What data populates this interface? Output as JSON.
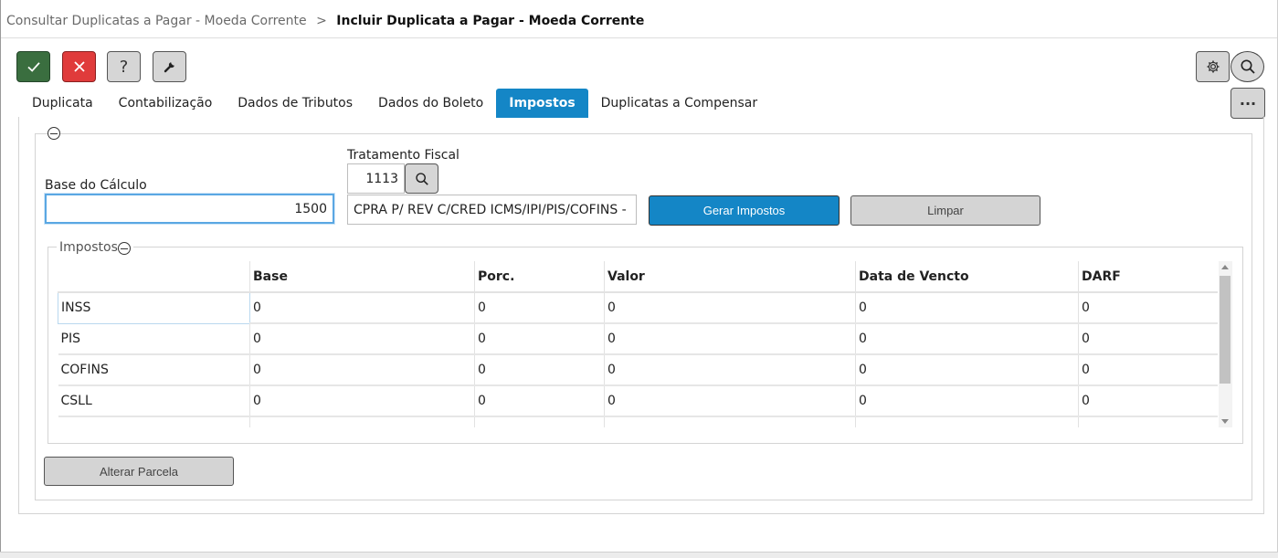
{
  "breadcrumb": {
    "parent": "Consultar Duplicatas a Pagar - Moeda Corrente",
    "separator": ">",
    "current": "Incluir Duplicata a Pagar - Moeda Corrente"
  },
  "toolbar": {
    "confirm_icon": "check-icon",
    "cancel_icon": "close-icon",
    "help_label": "?",
    "tools_icon": "wrench-icon",
    "settings_icon": "gear-icon",
    "search_icon": "search-icon",
    "more_label": "···"
  },
  "tabs": [
    {
      "label": "Duplicata",
      "active": false
    },
    {
      "label": "Contabilização",
      "active": false
    },
    {
      "label": "Dados de Tributos",
      "active": false
    },
    {
      "label": "Dados do Boleto",
      "active": false
    },
    {
      "label": "Impostos",
      "active": true
    },
    {
      "label": "Duplicatas a Compensar",
      "active": false
    }
  ],
  "form": {
    "base_label": "Base do Cálculo",
    "base_value": "1500",
    "tratamento_label": "Tratamento Fiscal",
    "tratamento_code": "1113",
    "tratamento_desc": "CPRA P/ REV C/CRED ICMS/IPI/PIS/COFINS - IF",
    "gerar_label": "Gerar Impostos",
    "limpar_label": "Limpar"
  },
  "impostos": {
    "legend": "Impostos",
    "columns": [
      "",
      "Base",
      "Porc.",
      "Valor",
      "Data de Vencto",
      "DARF"
    ],
    "rows": [
      [
        "INSS",
        "0",
        "0",
        "0",
        "0",
        "0"
      ],
      [
        "PIS",
        "0",
        "0",
        "0",
        "0",
        "0"
      ],
      [
        "COFINS",
        "0",
        "0",
        "0",
        "0",
        "0"
      ],
      [
        "CSLL",
        "0",
        "0",
        "0",
        "0",
        "0"
      ],
      [
        "",
        "",
        "",
        "",
        "",
        ""
      ]
    ]
  },
  "alterar_label": "Alterar Parcela",
  "colors": {
    "accent": "#1486c6",
    "confirm": "#3a6e3f",
    "cancel": "#e03b3b",
    "neutral_button": "#d6d6d6"
  }
}
